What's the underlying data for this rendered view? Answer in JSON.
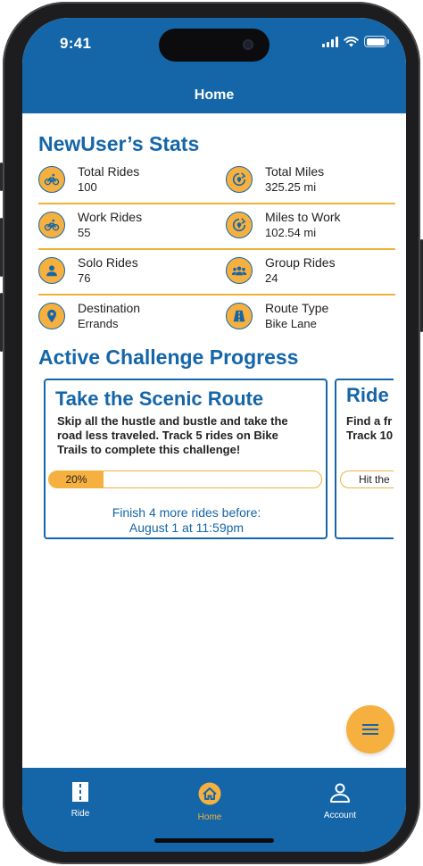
{
  "status": {
    "time": "9:41"
  },
  "header": {
    "title": "Home"
  },
  "stats": {
    "title": "NewUser’s Stats",
    "rows": [
      [
        {
          "label": "Total Rides",
          "value": "100",
          "icon": "bike-icon"
        },
        {
          "label": "Total Miles",
          "value": "325.25 mi",
          "icon": "route-icon"
        }
      ],
      [
        {
          "label": "Work Rides",
          "value": "55",
          "icon": "bike-icon"
        },
        {
          "label": "Miles to Work",
          "value": "102.54 mi",
          "icon": "route-icon"
        }
      ],
      [
        {
          "label": "Solo Rides",
          "value": "76",
          "icon": "person-icon"
        },
        {
          "label": "Group Rides",
          "value": "24",
          "icon": "group-icon"
        }
      ],
      [
        {
          "label": "Destination",
          "value": "Errands",
          "icon": "location-pin-icon"
        },
        {
          "label": "Route Type",
          "value": "Bike Lane",
          "icon": "road-icon"
        }
      ]
    ]
  },
  "challenges": {
    "title": "Active Challenge Progress",
    "items": [
      {
        "title": "Take the Scenic Route",
        "description": "Skip all the hustle and bustle and take the road less traveled. Track 5 rides on Bike Trails to complete this challenge!",
        "progress_label": "20%",
        "progress": 0.2,
        "footer_line1": "Finish 4 more rides before:",
        "footer_line2": "August 1 at 11:59pm"
      },
      {
        "title": "Ride",
        "description_line1": "Find a fr",
        "description_line2": "Track 10",
        "button_label": "Hit the"
      }
    ]
  },
  "fab": {
    "icon": "menu-icon"
  },
  "tabs": [
    {
      "label": "Ride",
      "icon": "road-icon",
      "active": false
    },
    {
      "label": "Home",
      "icon": "home-icon",
      "active": true
    },
    {
      "label": "Account",
      "icon": "account-icon",
      "active": false
    }
  ],
  "colors": {
    "primary": "#1566a8",
    "accent": "#f5b03f",
    "text": "#222222"
  }
}
